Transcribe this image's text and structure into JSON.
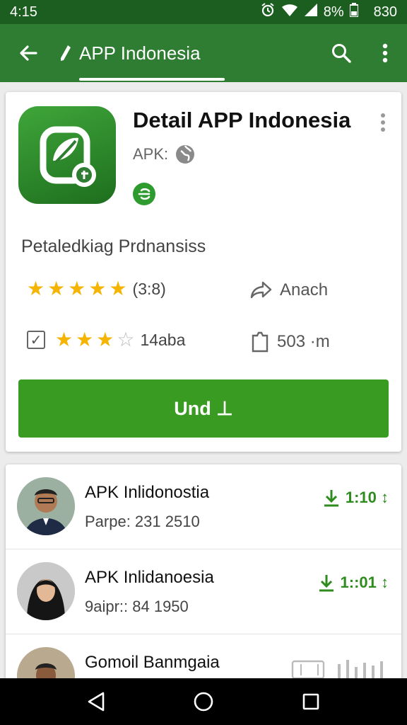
{
  "status_bar": {
    "time": "4:15",
    "battery": "8%",
    "clock_right": "830"
  },
  "app_bar": {
    "title": "APP Indonesia",
    "icons": [
      "back-arrow-icon",
      "pencil-icon",
      "search-icon",
      "overflow-menu-icon"
    ]
  },
  "detail": {
    "title": "Detail APP Indonesia",
    "apk_label": "APK:",
    "subtitle": "Petaledkiag Prdnansiss",
    "rating_stars": 5,
    "rating_text": "(3:8)",
    "share_label": "Anach",
    "review_stars": 3,
    "review_text": "14aba",
    "size_text": "503 ·m",
    "install_label": "Und ⊥",
    "accent_color": "#3a9b22"
  },
  "list": {
    "items": [
      {
        "title": "APK Inlidonostia",
        "sub": "Parpe: 231 2510",
        "right": "1:10 ↕"
      },
      {
        "title": "APK Inlidanoesia",
        "sub": "9aipr:: 84 1950",
        "right": "1::01 ↕"
      },
      {
        "title": "Gomoil Banmgaia",
        "sub": "",
        "right": ""
      }
    ]
  },
  "nav_bar": {
    "icons": [
      "nav-back-icon",
      "nav-home-icon",
      "nav-recents-icon"
    ]
  }
}
